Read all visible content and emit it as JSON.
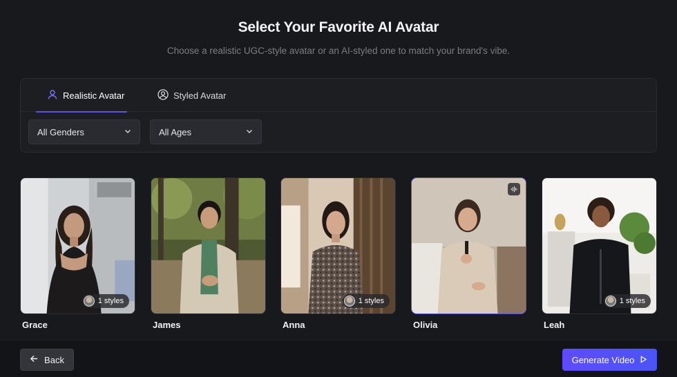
{
  "header": {
    "title": "Select Your Favorite AI Avatar",
    "subtitle": "Choose a realistic UGC-style avatar or an AI-styled one to match your brand's vibe."
  },
  "tabs": [
    {
      "label": "Realistic Avatar",
      "icon": "user-icon",
      "active": true
    },
    {
      "label": "Styled Avatar",
      "icon": "user-circle-icon",
      "active": false
    }
  ],
  "filters": {
    "gender": "All Genders",
    "age": "All Ages"
  },
  "avatars": [
    {
      "name": "Grace",
      "styles": "1 styles",
      "selected": false,
      "has_audio": false
    },
    {
      "name": "James",
      "styles": "",
      "selected": false,
      "has_audio": false
    },
    {
      "name": "Anna",
      "styles": "1 styles",
      "selected": false,
      "has_audio": false
    },
    {
      "name": "Olivia",
      "styles": "",
      "selected": true,
      "has_audio": true
    },
    {
      "name": "Leah",
      "styles": "1 styles",
      "selected": false,
      "has_audio": false
    }
  ],
  "footer": {
    "back_label": "Back",
    "generate_label": "Generate Video"
  },
  "colors": {
    "accent": "#5b54e8",
    "background": "#18191d",
    "panel": "#1d1e22"
  }
}
